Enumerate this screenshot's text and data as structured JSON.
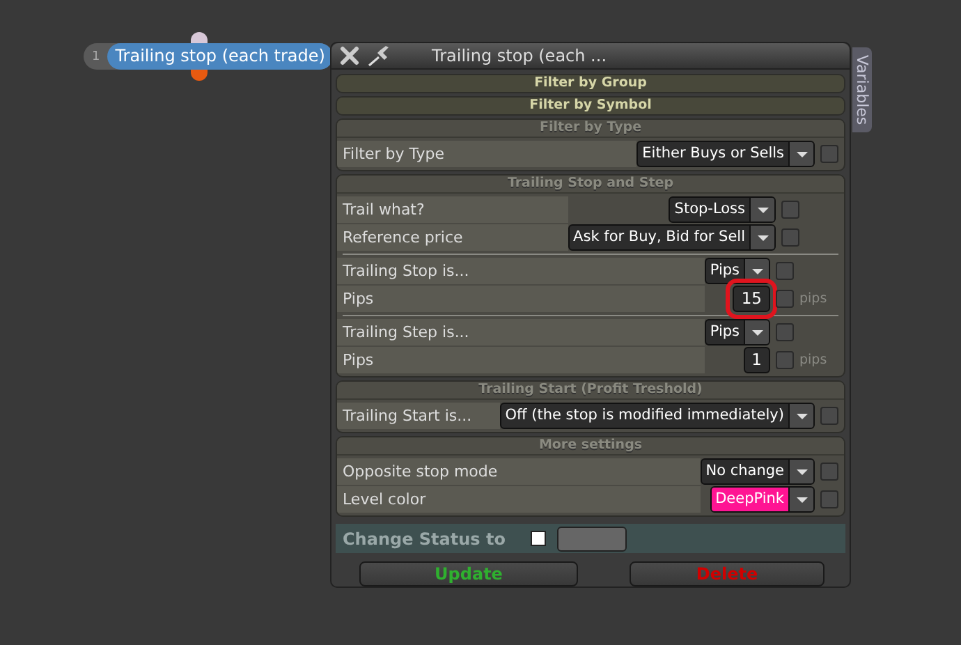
{
  "node": {
    "index": "1",
    "label": "Trailing stop (each trade)"
  },
  "dialog": {
    "title": "Trailing stop (each ...",
    "side_tab": "Variables",
    "sections": [
      {
        "header": "Filter by Group",
        "expanded": false
      },
      {
        "header": "Filter by Symbol",
        "expanded": false
      },
      {
        "header": "Filter by Type",
        "expanded": true,
        "groups": [
          [
            {
              "kind": "dropdown",
              "label": "Filter by Type",
              "value": "Either Buys or Sells",
              "checked": false
            }
          ]
        ]
      },
      {
        "header": "Trailing Stop and Step",
        "expanded": true,
        "groups": [
          [
            {
              "kind": "dropdown",
              "label": "Trail what?",
              "value": "Stop-Loss",
              "checked": false
            },
            {
              "kind": "dropdown",
              "label": "Reference price",
              "value": "Ask for Buy, Bid for Sell",
              "checked": false
            }
          ],
          [
            {
              "kind": "dropdown",
              "label": "Trailing Stop is...",
              "value": "Pips",
              "checked": false
            },
            {
              "kind": "number",
              "label": "Pips",
              "value": "15",
              "checked": false,
              "unit": "pips",
              "highlighted": true
            }
          ],
          [
            {
              "kind": "dropdown",
              "label": "Trailing Step is...",
              "value": "Pips",
              "checked": false
            },
            {
              "kind": "number",
              "label": "Pips",
              "value": "1",
              "checked": false,
              "unit": "pips",
              "highlighted": false
            }
          ]
        ]
      },
      {
        "header": "Trailing Start (Profit Treshold)",
        "expanded": true,
        "groups": [
          [
            {
              "kind": "dropdown",
              "label": "Trailing Start is...",
              "value": "Off (the stop is modified immediately)",
              "checked": false
            }
          ]
        ]
      },
      {
        "header": "More settings",
        "expanded": true,
        "groups": [
          [
            {
              "kind": "dropdown",
              "label": "Opposite stop mode",
              "value": "No change",
              "checked": false
            },
            {
              "kind": "color",
              "label": "Level color",
              "value": "DeepPink",
              "color": "#ff1493",
              "checked": false
            }
          ]
        ]
      }
    ],
    "status": {
      "label": "Change Status to",
      "checked": false
    },
    "buttons": [
      {
        "label": "Update",
        "kind": "update"
      },
      {
        "label": "Delete",
        "kind": "delete"
      }
    ]
  }
}
